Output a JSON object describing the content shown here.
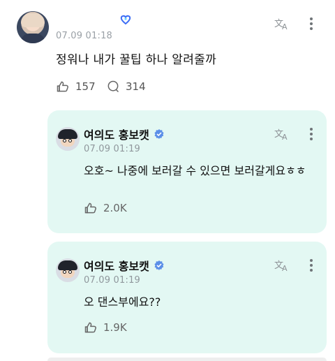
{
  "post": {
    "time": "07.09 01:18",
    "text": "정워나 내가 꿀팁 하나 알려줄까",
    "likes": "157",
    "comments": "314"
  },
  "replies": [
    {
      "author": "여의도 홍보캣",
      "time": "07.09 01:19",
      "text": "오호~ 나중에 보러갈 수 있으면 보러갈게요ㅎㅎ",
      "likes": "2.0K"
    },
    {
      "author": "여의도 홍보캣",
      "time": "07.09 01:19",
      "text": "오 댄스부에요??",
      "likes": "1.9K"
    }
  ],
  "icons": {
    "translate": "translate-icon",
    "more": "more-vertical-icon",
    "like": "like-icon",
    "comment": "comment-icon",
    "verified": "verified-icon",
    "badge": "heart-badge-icon"
  },
  "colors": {
    "reply_background": "#e3f8f3",
    "verified": "#5b8fe8",
    "badge": "#3b6cf5"
  }
}
